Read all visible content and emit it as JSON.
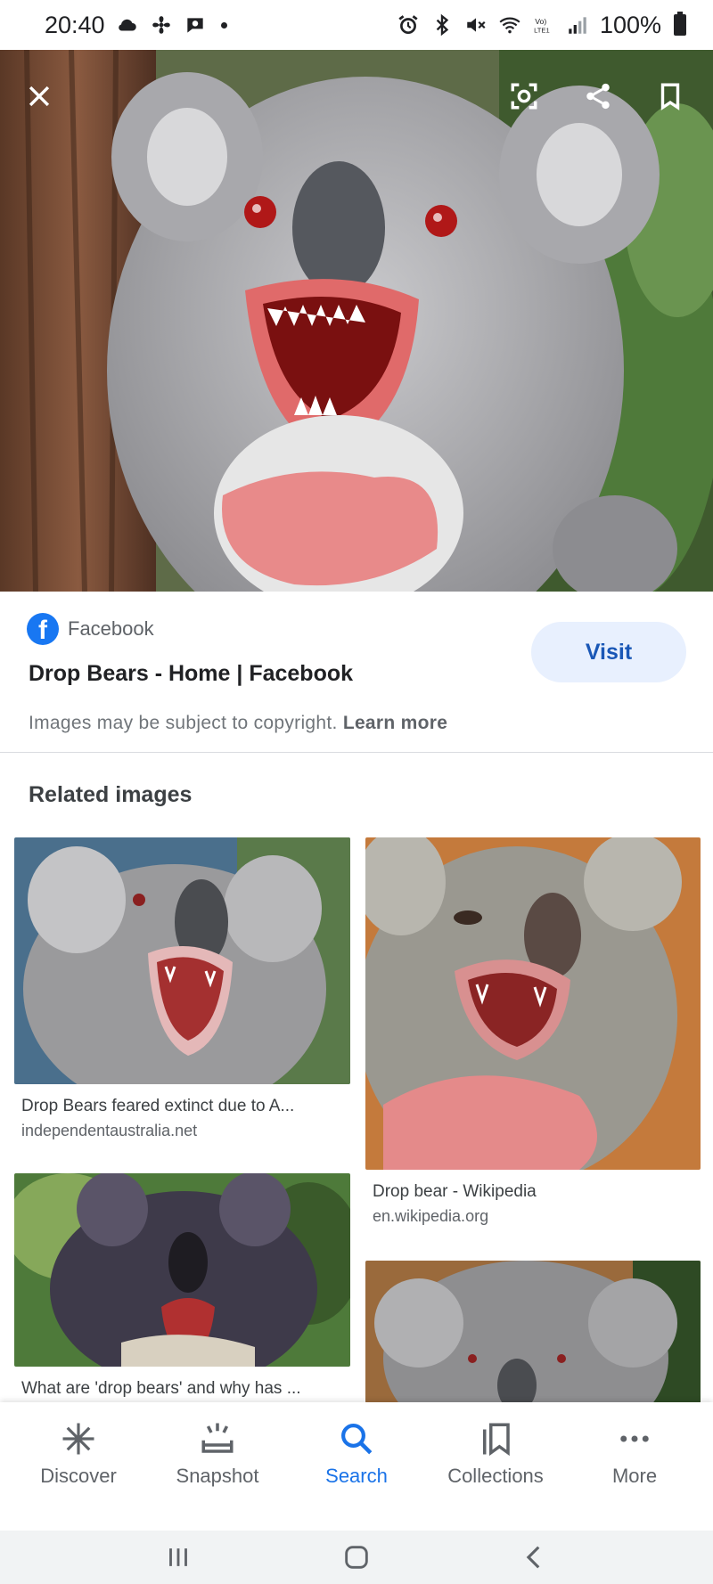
{
  "status_bar": {
    "time": "20:40",
    "left_icons": [
      "cloud-icon",
      "fan-icon",
      "chat-icon",
      "dot"
    ],
    "right_icons": [
      "alarm-icon",
      "bluetooth-icon",
      "mute-icon",
      "wifi-icon",
      "volte-icon",
      "signal-icon"
    ],
    "battery": "100%"
  },
  "viewer": {
    "actions": [
      "close-icon",
      "lens-icon",
      "share-icon",
      "bookmark-icon"
    ]
  },
  "source": {
    "site_name": "Facebook",
    "page_title": "Drop Bears - Home | Facebook",
    "visit_label": "Visit",
    "copyright_text": "Images may be subject to copyright.",
    "learn_more": "Learn more"
  },
  "related": {
    "title": "Related images",
    "items": [
      {
        "title": "Drop Bears feared extinct due to A...",
        "url": "independentaustralia.net"
      },
      {
        "title": "Drop bear - Wikipedia",
        "url": "en.wikipedia.org"
      },
      {
        "title": "What are 'drop bears' and why has ...",
        "url": ""
      },
      {
        "title": "",
        "url": ""
      }
    ]
  },
  "bottom_nav": {
    "items": [
      {
        "label": "Discover",
        "icon": "asterisk-icon"
      },
      {
        "label": "Snapshot",
        "icon": "snapshot-icon"
      },
      {
        "label": "Search",
        "icon": "search-icon"
      },
      {
        "label": "Collections",
        "icon": "collections-icon"
      },
      {
        "label": "More",
        "icon": "more-icon"
      }
    ],
    "active": "Search",
    "active_color": "#1a73e8"
  },
  "system_nav": [
    "recents-icon",
    "home-icon",
    "back-icon"
  ]
}
